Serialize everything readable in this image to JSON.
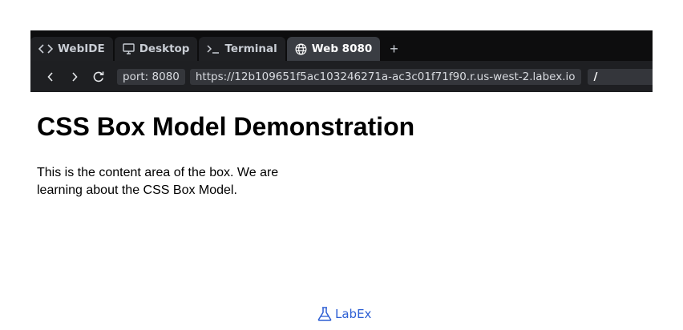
{
  "tabs": [
    {
      "label": "WebIDE",
      "icon": "code-icon",
      "active": false
    },
    {
      "label": "Desktop",
      "icon": "monitor-icon",
      "active": false
    },
    {
      "label": "Terminal",
      "icon": "terminal-icon",
      "active": false
    },
    {
      "label": "Web 8080",
      "icon": "globe-icon",
      "active": true
    }
  ],
  "tabbar": {
    "new_tab": "+"
  },
  "address": {
    "port": "port: 8080",
    "url": "https://12b109651f5ac103246271a-ac3c01f71f90.r.us-west-2.labex.io",
    "path": "/"
  },
  "page": {
    "title": "CSS Box Model Demonstration",
    "content": "This is the content area of the box. We are learning about the CSS Box Model."
  },
  "brand": {
    "name": "LabEx",
    "color": "#2d5fd4"
  },
  "colors": {
    "chrome": "#0d0d0e",
    "active_tab": "#3a3d43",
    "addressbar": "#1e1f22"
  }
}
